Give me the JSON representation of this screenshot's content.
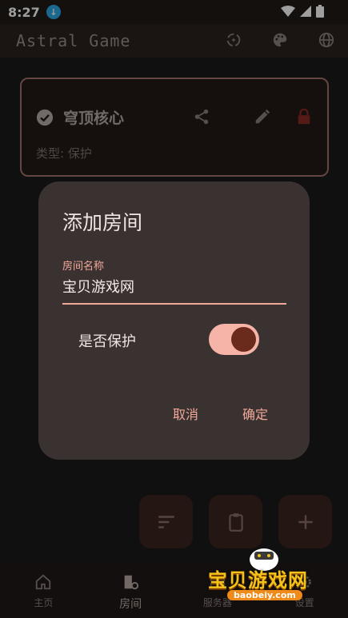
{
  "status_bar": {
    "time": "8:27"
  },
  "app_bar": {
    "title": "Astral Game"
  },
  "room_card": {
    "name": "穹顶核心",
    "type_label": "类型: 保护"
  },
  "dialog": {
    "title": "添加房间",
    "field_label": "房间名称",
    "field_value": "宝贝游戏网",
    "switch_label": "是否保护",
    "switch_on": true,
    "cancel": "取消",
    "confirm": "确定"
  },
  "bottom_nav": {
    "items": [
      {
        "label": "主页",
        "icon": "home-icon"
      },
      {
        "label": "房间",
        "icon": "room-icon"
      },
      {
        "label": "服务器",
        "icon": "server-icon"
      },
      {
        "label": "设置",
        "icon": "settings-icon"
      }
    ]
  },
  "watermark": {
    "text": "宝贝游戏网",
    "url": "baobeiy.com"
  },
  "colors": {
    "accent": "#f2a89a",
    "dialog_bg": "#3a3230",
    "card_border": "#a0726a"
  }
}
